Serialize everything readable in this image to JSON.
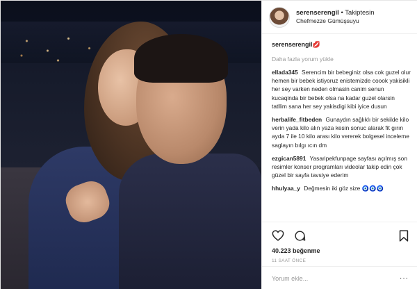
{
  "header": {
    "username": "serenserengil",
    "follow_status": "• Takiptesin",
    "location": "Chefmezze Gümüşsuyu"
  },
  "caption": {
    "username": "serenserengil",
    "emoji": "💋"
  },
  "load_more": "Daha fazla yorum yükle",
  "comments": [
    {
      "user": "ellada345",
      "text": "Serencim bir bebeginiz olsa cok guzel olur hemen bir bebek istiyoruz enistemizde coook yakisikli her sey varken neden olmasin canim senun kucaqinda bir bebek olsa na kadar guzel olarsin tatllim sana her sey yakisdigi kibi iyice dusun"
    },
    {
      "user": "herbalife_fitbeden",
      "text": "Gunaydın sağlıklı bir sekilde kilo verin yada kilo alın yaza kesin sonuc alarak fit gırın ayda 7 ile 10 kilo arası kilo vererek bolgesel inceleme saglayın bılgı ıcın dm"
    },
    {
      "user": "ezgican5891",
      "text": "Yasaripekfunpage sayfası açılmış son resimler konser programları videolar takip edin çok güzel bir sayfa tavsiye ederim"
    },
    {
      "user": "hhulyaa_y",
      "text": "Değmesin iki göz size 🧿🧿🧿"
    }
  ],
  "likes": "40.223 beğenme",
  "timestamp": "11 SAAT ÖNCE",
  "comment_input": {
    "placeholder": "Yorum ekle..."
  },
  "more_options": "···",
  "icons": [
    "heart-icon",
    "comment-icon",
    "bookmark-icon"
  ]
}
